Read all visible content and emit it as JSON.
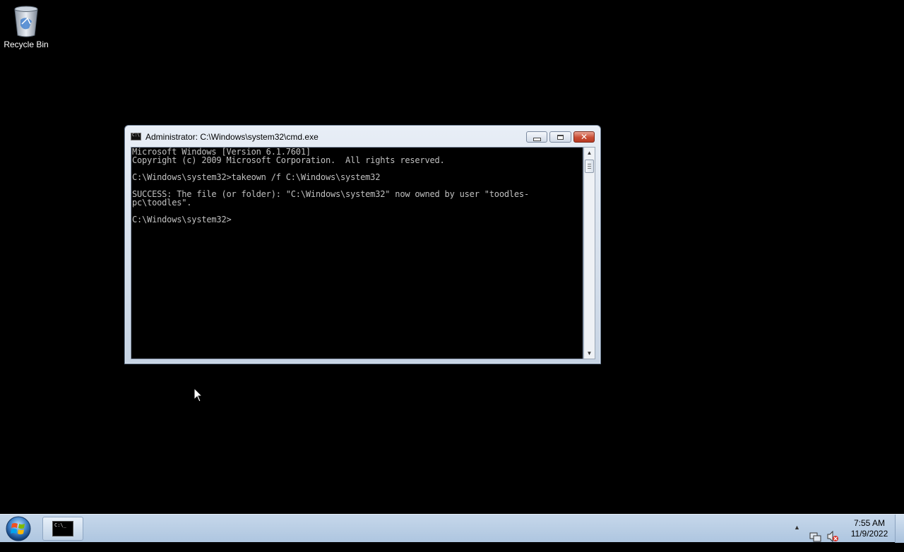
{
  "desktop": {
    "icons": [
      {
        "label": "Recycle Bin",
        "icon": "recycle-bin-icon"
      }
    ]
  },
  "cmd_window": {
    "title": "Administrator: C:\\Windows\\system32\\cmd.exe",
    "title_icon_text": "C:\\",
    "console_lines": "Microsoft Windows [Version 6.1.7601]\nCopyright (c) 2009 Microsoft Corporation.  All rights reserved.\n\nC:\\Windows\\system32>takeown /f C:\\Windows\\system32\n\nSUCCESS: The file (or folder): \"C:\\Windows\\system32\" now owned by user \"toodles-\npc\\toodles\".\n\nC:\\Windows\\system32>",
    "buttons": {
      "minimize": "minimize-icon",
      "maximize": "maximize-icon",
      "close": "close-icon"
    }
  },
  "taskbar": {
    "start": "windows-start-icon",
    "items": [
      {
        "icon": "command-prompt-icon",
        "icon_text": "C:\\_"
      }
    ],
    "tray": {
      "icons": [
        "show-hidden-icons-chevron-icon",
        "network-icon",
        "volume-muted-icon"
      ],
      "time": "7:55 AM",
      "date": "11/9/2022"
    }
  },
  "colors": {
    "desktop_background": "#000000",
    "console_background": "#000000",
    "console_text": "#c0c0c0",
    "taskbar": "#b9cfe6",
    "close_button": "#c94d35"
  }
}
